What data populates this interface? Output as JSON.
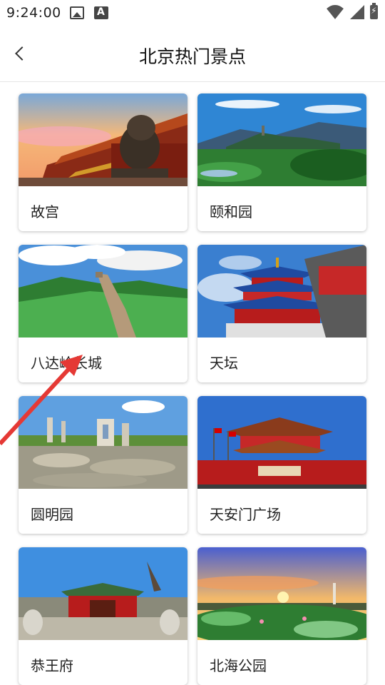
{
  "status": {
    "time": "9:24:00"
  },
  "header": {
    "title": "北京热门景点"
  },
  "attractions": [
    {
      "name": "故宫"
    },
    {
      "name": "颐和园"
    },
    {
      "name": "八达岭长城"
    },
    {
      "name": "天坛"
    },
    {
      "name": "圆明园"
    },
    {
      "name": "天安门广场"
    },
    {
      "name": "恭王府"
    },
    {
      "name": "北海公园"
    }
  ],
  "colors": {
    "annotation_arrow": "#e53935"
  }
}
